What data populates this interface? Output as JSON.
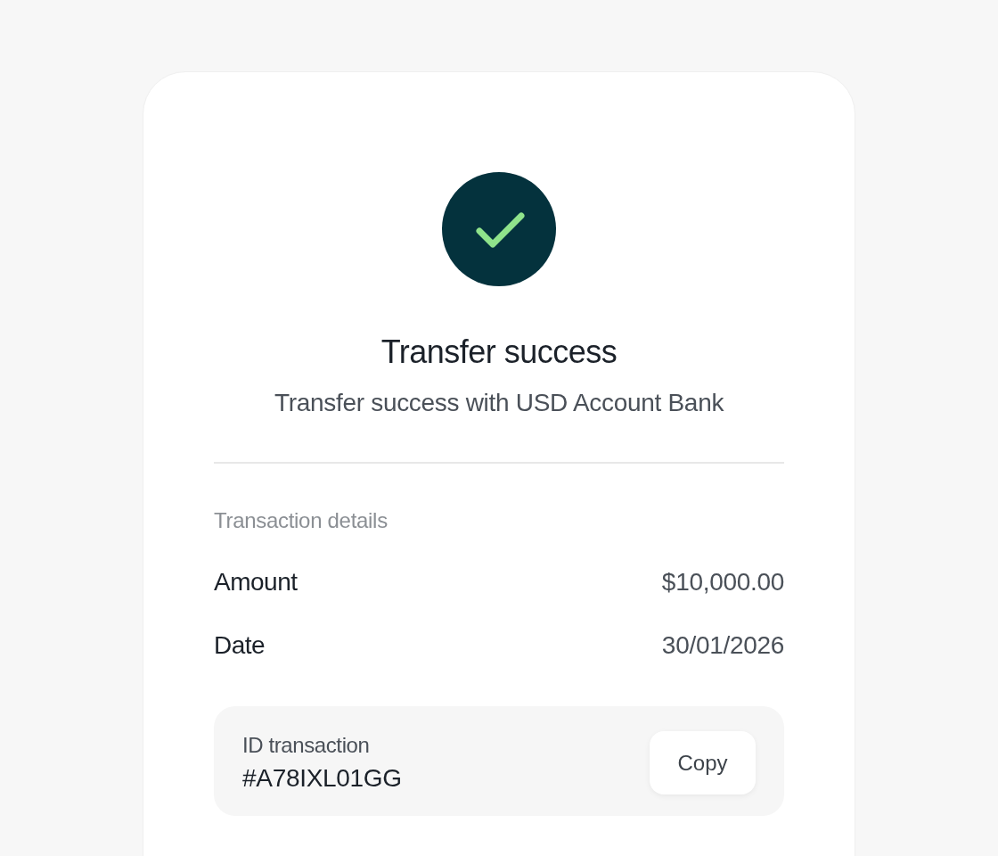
{
  "title": "Transfer success",
  "subtitle": "Transfer success with USD Account Bank",
  "details": {
    "heading": "Transaction details",
    "rows": [
      {
        "label": "Amount",
        "value": "$10,000.00"
      },
      {
        "label": "Date",
        "value": "30/01/2026"
      }
    ]
  },
  "transaction_id": {
    "label": "ID transaction",
    "value": "#A78IXL01GG",
    "button": "Copy"
  }
}
